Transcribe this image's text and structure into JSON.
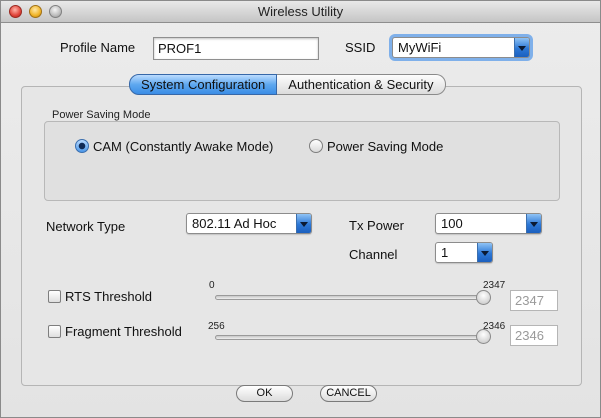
{
  "window": {
    "title": "Wireless Utility"
  },
  "profile": {
    "label": "Profile Name",
    "value": "PROF1"
  },
  "ssid": {
    "label": "SSID",
    "value": "MyWiFi"
  },
  "tabs": [
    {
      "label": "System Configuration",
      "active": true
    },
    {
      "label": "Authentication & Security",
      "active": false
    }
  ],
  "power_saving": {
    "title": "Power Saving Mode",
    "options": [
      {
        "label": "CAM (Constantly Awake Mode)",
        "selected": true
      },
      {
        "label": "Power Saving Mode",
        "selected": false
      }
    ]
  },
  "network_type": {
    "label": "Network Type",
    "value": "802.11 Ad Hoc"
  },
  "tx_power": {
    "label": "Tx Power",
    "value": "100"
  },
  "channel": {
    "label": "Channel",
    "value": "1"
  },
  "rts": {
    "label": "RTS Threshold",
    "checked": false,
    "min_label": "0",
    "max_label": "2347",
    "value": "2347",
    "slider_level": 1.0
  },
  "fragment": {
    "label": "Fragment Threshold",
    "checked": false,
    "min_label": "256",
    "max_label": "2346",
    "value": "2346",
    "slider_level": 1.0
  },
  "buttons": {
    "ok": "OK",
    "cancel": "CANCEL"
  },
  "colors": {
    "accent": "#3b8de6",
    "window_bg": "#e8e8e8"
  }
}
